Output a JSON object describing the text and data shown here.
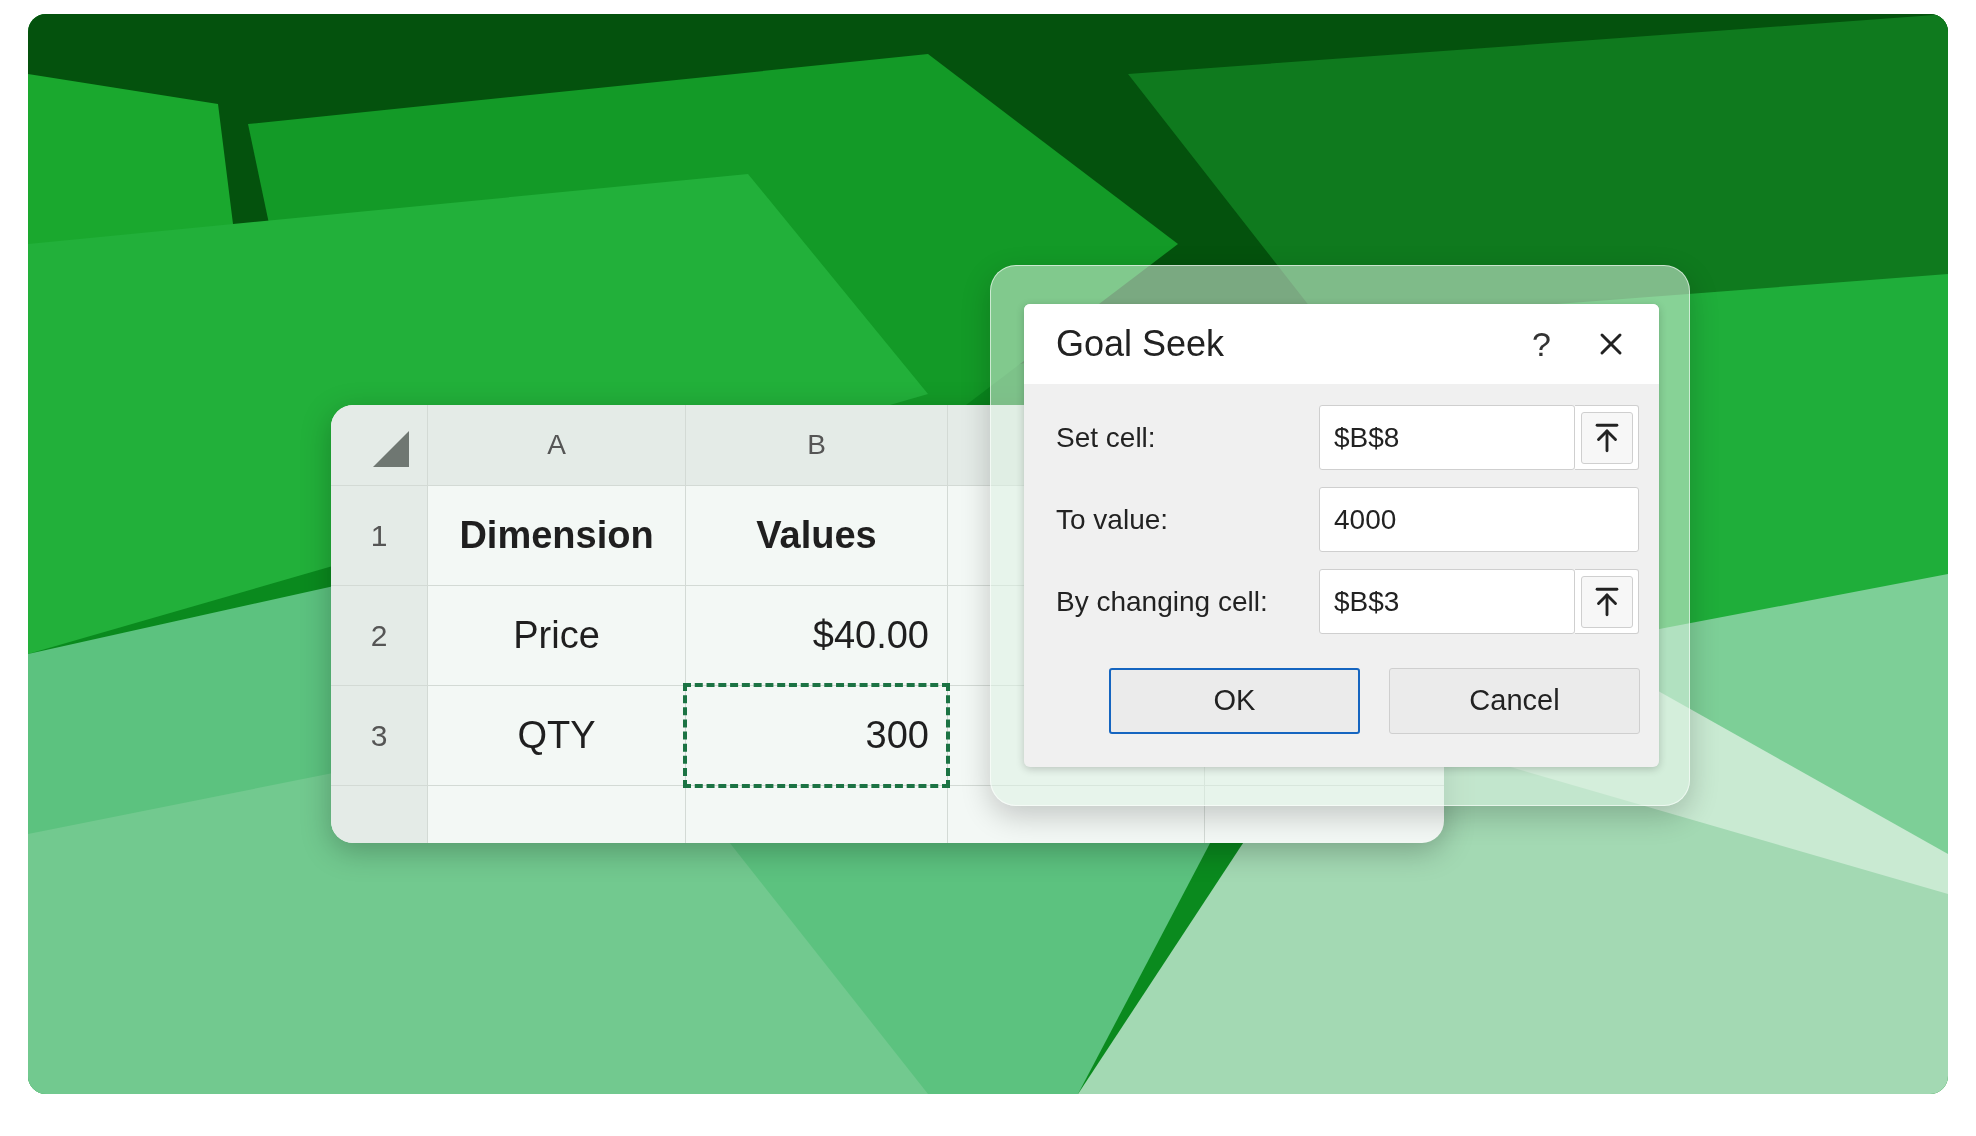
{
  "spreadsheet": {
    "columns": [
      "A",
      "B"
    ],
    "rows": [
      {
        "header": "1",
        "kind": "heading",
        "cells": [
          {
            "text": "Dimension",
            "marked": false
          },
          {
            "text": "Values",
            "marked": false
          }
        ]
      },
      {
        "header": "2",
        "kind": "data",
        "cells": [
          {
            "text": "Price",
            "marked": false
          },
          {
            "text": "$40.00",
            "marked": false
          }
        ]
      },
      {
        "header": "3",
        "kind": "data",
        "cells": [
          {
            "text": "QTY",
            "marked": false
          },
          {
            "text": "300",
            "marked": true
          }
        ]
      }
    ]
  },
  "dialog": {
    "title": "Goal Seek",
    "help": "?",
    "fields": [
      {
        "label": "Set cell:",
        "value": "$B$8",
        "picker": true
      },
      {
        "label": "To value:",
        "value": "4000",
        "picker": false
      },
      {
        "label": "By changing cell:",
        "value": "$B$3",
        "picker": true
      }
    ],
    "buttons": [
      {
        "label": "OK",
        "default": true
      },
      {
        "label": "Cancel",
        "default": false
      }
    ]
  }
}
